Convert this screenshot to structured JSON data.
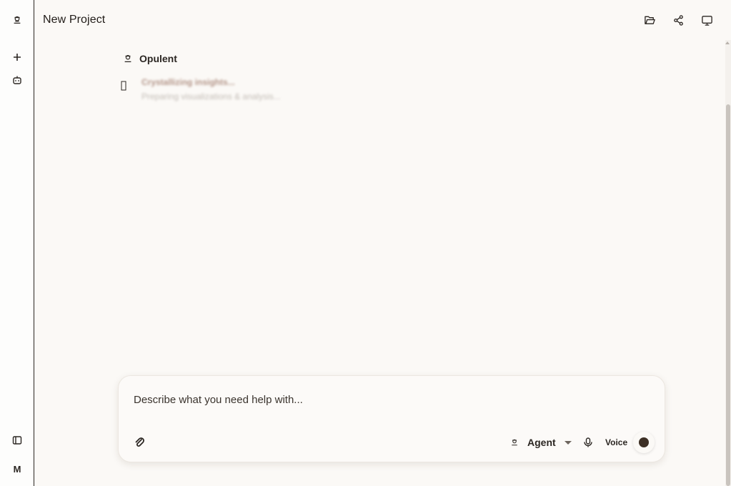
{
  "header": {
    "title": "New Project"
  },
  "sidebar": {
    "avatar_initial": "M"
  },
  "conversation": {
    "author": "Opulent",
    "thinking_title": "Crystallizing insights...",
    "thinking_detail": "Preparing visualizations & analysis..."
  },
  "composer": {
    "placeholder": "Describe what you need help with...",
    "mode_label": "Agent",
    "voice_label": "Voice"
  },
  "icons": {
    "logo": "opulent-logo-icon",
    "new": "plus-icon",
    "bot": "bot-icon",
    "panel": "sidebar-toggle-icon",
    "folder": "folder-open-icon",
    "share": "share-icon",
    "screen": "monitor-icon",
    "attach": "paperclip-icon",
    "mic": "microphone-icon"
  },
  "colors": {
    "accent": "#3d2f25",
    "background": "#fbf9f6"
  }
}
